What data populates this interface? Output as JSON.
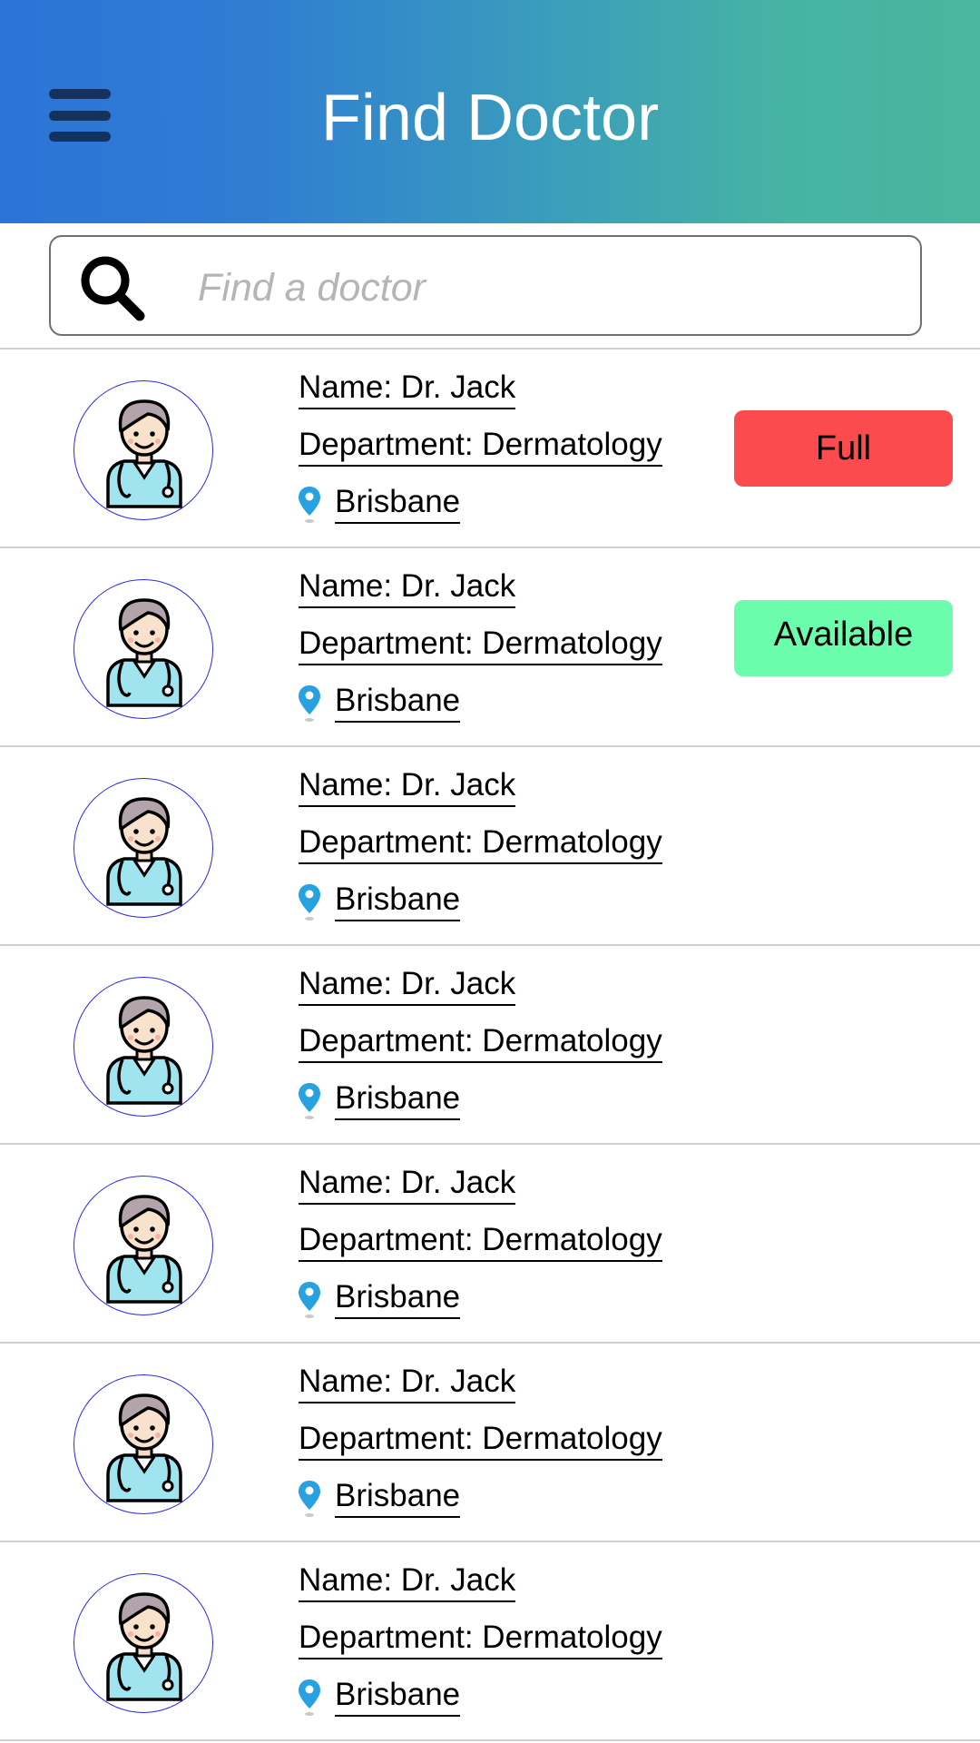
{
  "header": {
    "title": "Find Doctor",
    "menu_icon": "hamburger-menu-icon",
    "gradient_start": "#2b74d6",
    "gradient_end": "#4ab69e"
  },
  "search": {
    "placeholder": "Find a doctor",
    "icon": "search-icon"
  },
  "doctors": [
    {
      "name": "Name: Dr. Jack",
      "department": "Department: Dermatology",
      "location": "Brisbane",
      "status": "Full",
      "status_color": "#fb4b4e"
    },
    {
      "name": "Name: Dr. Jack",
      "department": "Department: Dermatology",
      "location": "Brisbane",
      "status": "Available",
      "status_color": "#6cfdac"
    },
    {
      "name": "Name: Dr. Jack",
      "department": "Department: Dermatology",
      "location": "Brisbane"
    },
    {
      "name": "Name: Dr. Jack",
      "department": "Department: Dermatology",
      "location": "Brisbane"
    },
    {
      "name": "Name: Dr. Jack",
      "department": "Department: Dermatology",
      "location": "Brisbane"
    },
    {
      "name": "Name: Dr. Jack",
      "department": "Department: Dermatology",
      "location": "Brisbane"
    },
    {
      "name": "Name: Dr. Jack",
      "department": "Department: Dermatology",
      "location": "Brisbane"
    }
  ]
}
